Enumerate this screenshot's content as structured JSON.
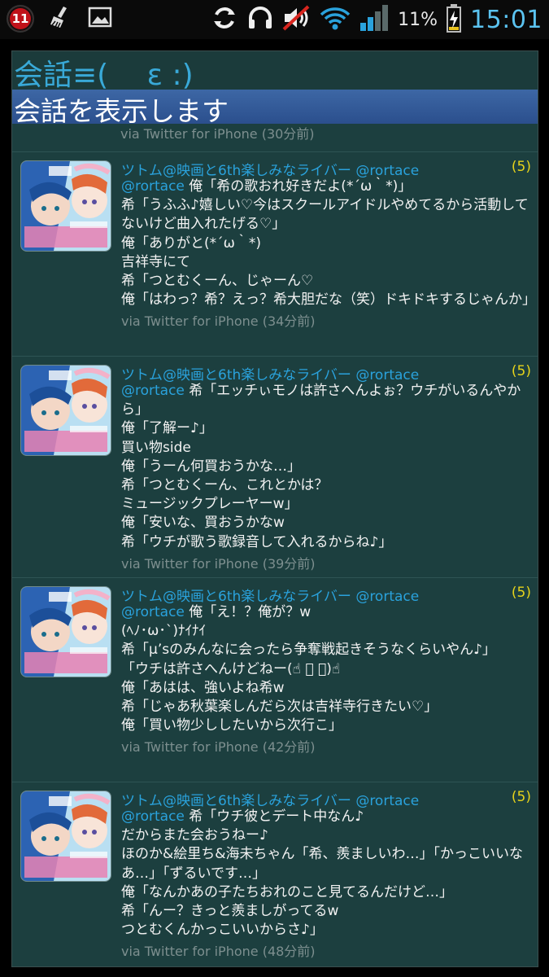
{
  "status_bar": {
    "notification_count": "11",
    "battery_percent": "11%",
    "time": "15:01",
    "icons": [
      "notification-badge-icon",
      "broom-icon",
      "image-icon",
      "sync-icon",
      "headphones-icon",
      "sound-muted-icon",
      "wifi-icon",
      "signal-icon",
      "battery-charging-icon"
    ]
  },
  "app": {
    "title": "会話≡(　 ε :)",
    "toast": "会話を表示します",
    "previous_via": "via Twitter for iPhone (30分前)"
  },
  "colors": {
    "panel_bg": "#1c3f3f",
    "name_color": "#2aa2dc",
    "count_color": "#e6d31b",
    "clock_color": "#5bc3f0"
  },
  "tweets": [
    {
      "name": "ツトム@映画と6th楽しみなライバー @rortace",
      "count": "(5)",
      "mention": "@rortace",
      "text": " 俺「希の歌おれ好きだよ(*´ω｀*)」\n希「うふふ♪嬉しい♡今はスクールアイドルやめてるから活動してないけど曲入れたげる♡」\n俺「ありがと(*´ω｀*)\n吉祥寺にて\n希「つとむくーん、じゃーん♡\n俺「はわっ？希？えっ？希大胆だな（笑）ドキドキするじゃんか」",
      "via": "via Twitter for iPhone (34分前)"
    },
    {
      "name": "ツトム@映画と6th楽しみなライバー @rortace",
      "count": "(5)",
      "mention": "@rortace",
      "text": " 希「エッチぃモノは許さへんよぉ？ウチがいるんやから」\n俺「了解ー♪」\n買い物side\n俺「うーん何買おうかな…」\n希「つとむくーん、これとかは？\nミュージックプレーヤーw」\n俺「安いな、買おうかなw\n希「ウチが歌う歌録音して入れるからね♪」",
      "via": "via Twitter for iPhone (39分前)"
    },
    {
      "name": "ツトム@映画と6th楽しみなライバー @rortace",
      "count": "(5)",
      "mention": "@rortace",
      "text": " 俺「え！？俺が？w\n(ﾍﾉ･ω･`)ﾅｲﾅｲ\n希「μ’sのみんなに会ったら争奪戦起きそうなくらいやん♪」\n「ウチは許さへんけどねー(☝ ﾟ ﾟ)☝\n俺「あはは、強いよね希w\n希「じゃあ秋葉楽しんだら次は吉祥寺行きたい♡」\n俺「買い物少ししたいから次行こ」",
      "via": "via Twitter for iPhone (42分前)"
    },
    {
      "name": "ツトム@映画と6th楽しみなライバー @rortace",
      "count": "(5)",
      "mention": "@rortace",
      "text": " 希「ウチ彼とデート中なん♪\nだからまた会おうねー♪\nほのか&絵里ち&海未ちゃん「希、羨ましいわ…」「かっこいいなあ…」「ずるいです…」\n俺「なんかあの子たちおれのこと見てるんだけど…」\n希「んー？きっと羨ましがってるw\nつとむくんかっこいいからさ♪」",
      "via": "via Twitter for iPhone (48分前)"
    }
  ]
}
